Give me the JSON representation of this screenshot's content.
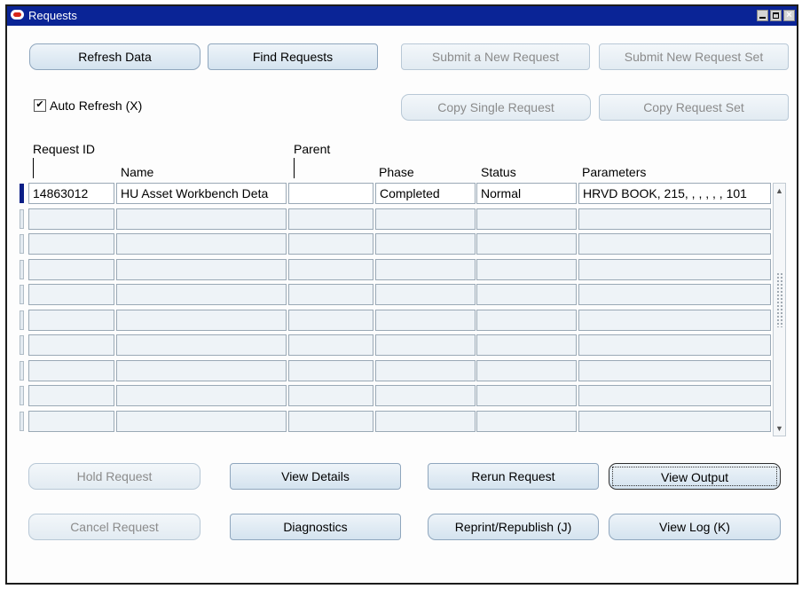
{
  "window": {
    "title": "Requests"
  },
  "buttons": {
    "refresh": "Refresh Data",
    "find": "Find Requests",
    "submit_new": "Submit a New Request",
    "submit_set": "Submit New Request Set",
    "copy_single": "Copy Single Request",
    "copy_set": "Copy Request Set",
    "hold": "Hold Request",
    "view_details": "View Details",
    "rerun": "Rerun Request",
    "view_output": "View Output",
    "cancel": "Cancel Request",
    "diagnostics": "Diagnostics",
    "reprint": "Reprint/Republish (J)",
    "view_log": "View Log (K)"
  },
  "auto_refresh": {
    "label": "Auto Refresh (X)",
    "checked": true
  },
  "table": {
    "headers": {
      "request_id": "Request ID",
      "name": "Name",
      "parent": "Parent",
      "phase": "Phase",
      "status": "Status",
      "parameters": "Parameters"
    },
    "rows": [
      {
        "request_id": "14863012",
        "name": "HU Asset Workbench Deta",
        "parent": "",
        "phase": "Completed",
        "status": "Normal",
        "parameters": "HRVD BOOK, 215, , , , , , 101"
      }
    ]
  }
}
